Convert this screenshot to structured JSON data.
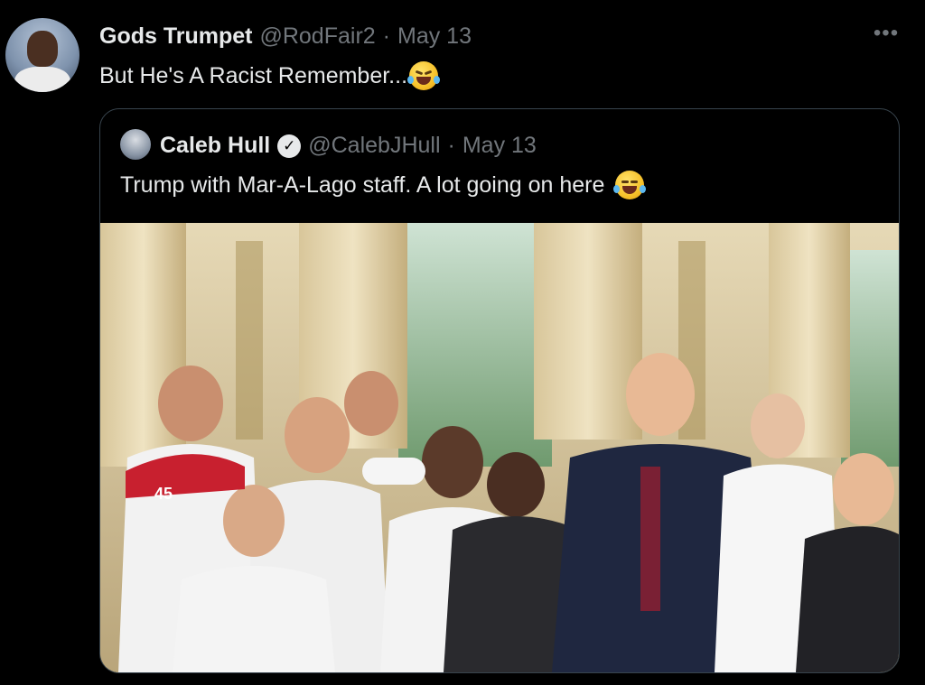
{
  "tweet": {
    "display_name": "Gods Trumpet",
    "handle": "@RodFair2",
    "separator": "·",
    "date": "May 13",
    "text": "But He's A Racist Remember...",
    "emoji": "rolling-on-floor-laughing-emoji",
    "more_label": "•••"
  },
  "quoted_tweet": {
    "display_name": "Caleb Hull",
    "verified_icon": "verified-badge-icon",
    "verified_glyph": "✓",
    "handle": "@CalebJHull",
    "separator": "·",
    "date": "May 13",
    "text": "Trump with Mar-A-Lago staff. A lot going on here",
    "emoji": "face-with-tears-of-joy-emoji"
  },
  "media": {
    "cap_text": "45"
  },
  "colors": {
    "background": "#000000",
    "text_primary": "#e7e9ea",
    "text_secondary": "#71767b",
    "card_border": "#38444d"
  }
}
